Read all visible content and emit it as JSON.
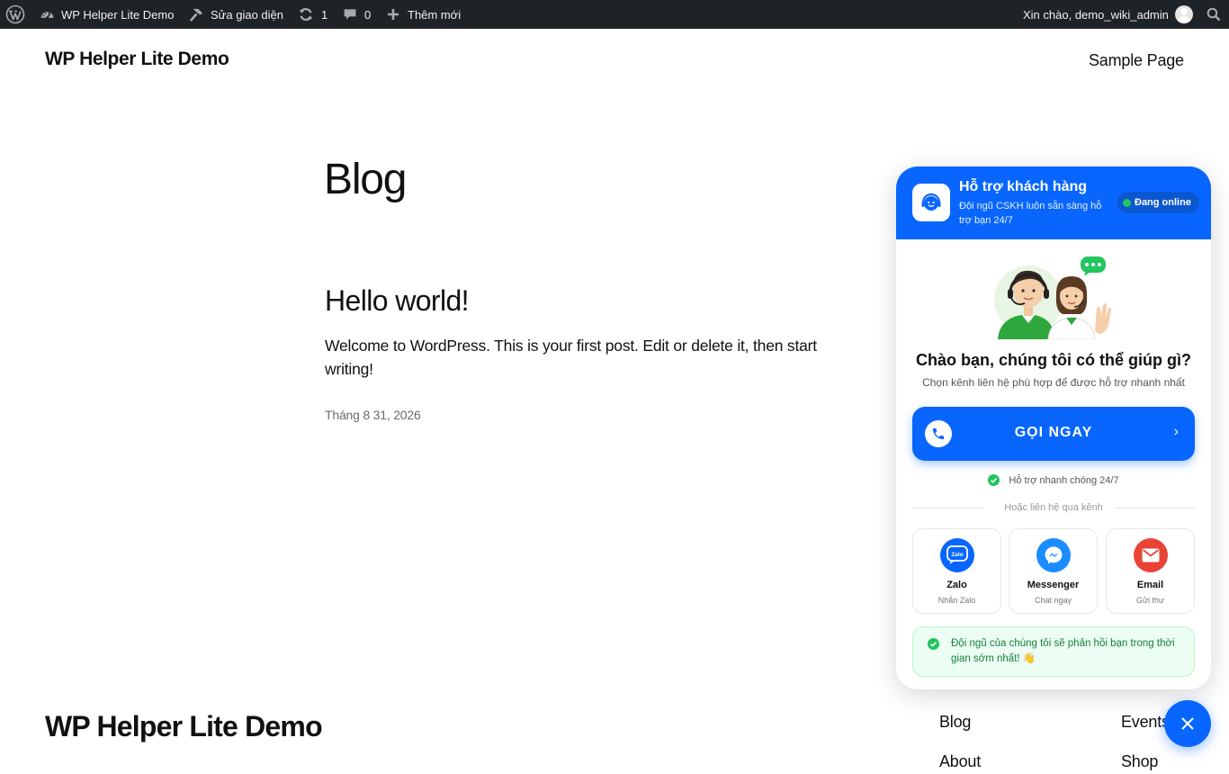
{
  "adminbar": {
    "wp_logo": "wordpress-logo-icon",
    "site_name": "WP Helper Lite Demo",
    "customize": "Sửa giao diện",
    "updates_count": "1",
    "comments_count": "0",
    "new_label": "Thêm mới",
    "greeting": "Xin chào, demo_wiki_admin"
  },
  "header": {
    "site_title": "WP Helper Lite Demo",
    "nav": [
      "Sample Page"
    ]
  },
  "main": {
    "page_title": "Blog",
    "posts": [
      {
        "title": "Hello world!",
        "excerpt": "Welcome to WordPress. This is your first post. Edit or delete it, then start writing!",
        "date": "Tháng 8 31, 2026"
      }
    ]
  },
  "footer": {
    "site_title": "WP Helper Lite Demo",
    "links": [
      "Blog",
      "Events",
      "About",
      "Shop"
    ]
  },
  "widget": {
    "header_title": "Hỗ trợ khách hàng",
    "header_sub": "Đội ngũ CSKH luôn sẵn sàng hỗ trợ bạn 24/7",
    "status": "Đang online",
    "question": "Chào bạn, chúng tôi có thể giúp gì?",
    "question_sub": "Chọn kênh liên hệ phù hợp để được hỗ trợ nhanh nhất",
    "call_label": "GỌI NGAY",
    "fast_support": "Hỗ trợ nhanh chóng 24/7",
    "or_label": "Hoặc liên hệ qua kênh",
    "zalo_icon_text": "Zalo",
    "channels": [
      {
        "name": "Zalo",
        "sub": "Nhắn Zalo",
        "icon": "zalo-icon",
        "color": "#0866ff"
      },
      {
        "name": "Messenger",
        "sub": "Chat ngay",
        "icon": "messenger-icon",
        "color": "#1a8cff"
      },
      {
        "name": "Email",
        "sub": "Gửi thư",
        "icon": "email-icon",
        "color": "#ea4335"
      }
    ],
    "note": "Đội ngũ của chúng tôi sẽ phản hồi bạn trong thời gian sớm nhất! 👋"
  },
  "colors": {
    "admin_bar": "#1d2327",
    "accent": "#0866ff",
    "success": "#22c55e"
  }
}
